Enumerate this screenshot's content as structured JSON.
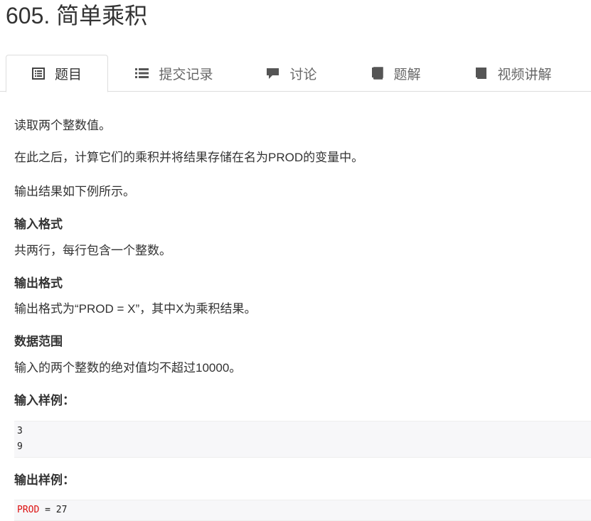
{
  "problem": {
    "title": "605. 简单乘积"
  },
  "tabs": [
    {
      "label": "题目",
      "icon": "document-list-icon",
      "active": true
    },
    {
      "label": "提交记录",
      "icon": "list-icon",
      "active": false
    },
    {
      "label": "讨论",
      "icon": "comment-icon",
      "active": false
    },
    {
      "label": "题解",
      "icon": "book-icon",
      "active": false
    },
    {
      "label": "视频讲解",
      "icon": "book-icon",
      "active": false
    }
  ],
  "description": {
    "p1": "读取两个整数值。",
    "p2": "在此之后，计算它们的乘积并将结果存储在名为PROD的变量中。",
    "p3": "输出结果如下例所示。"
  },
  "input_format": {
    "heading": "输入格式",
    "text": "共两行，每行包含一个整数。"
  },
  "output_format": {
    "heading": "输出格式",
    "text": "输出格式为“PROD = X”，其中X为乘积结果。"
  },
  "data_range": {
    "heading": "数据范围",
    "text": "输入的两个整数的绝对值均不超过10000。"
  },
  "sample_input": {
    "heading": "输入样例：",
    "lines": [
      "3",
      "9"
    ]
  },
  "sample_output": {
    "heading": "输出样例：",
    "keyword": "PROD",
    "rest": " = 27"
  },
  "colors": {
    "keyword": "#dd1111",
    "tab_border": "#dddddd",
    "code_bg": "#f7f7f9"
  }
}
